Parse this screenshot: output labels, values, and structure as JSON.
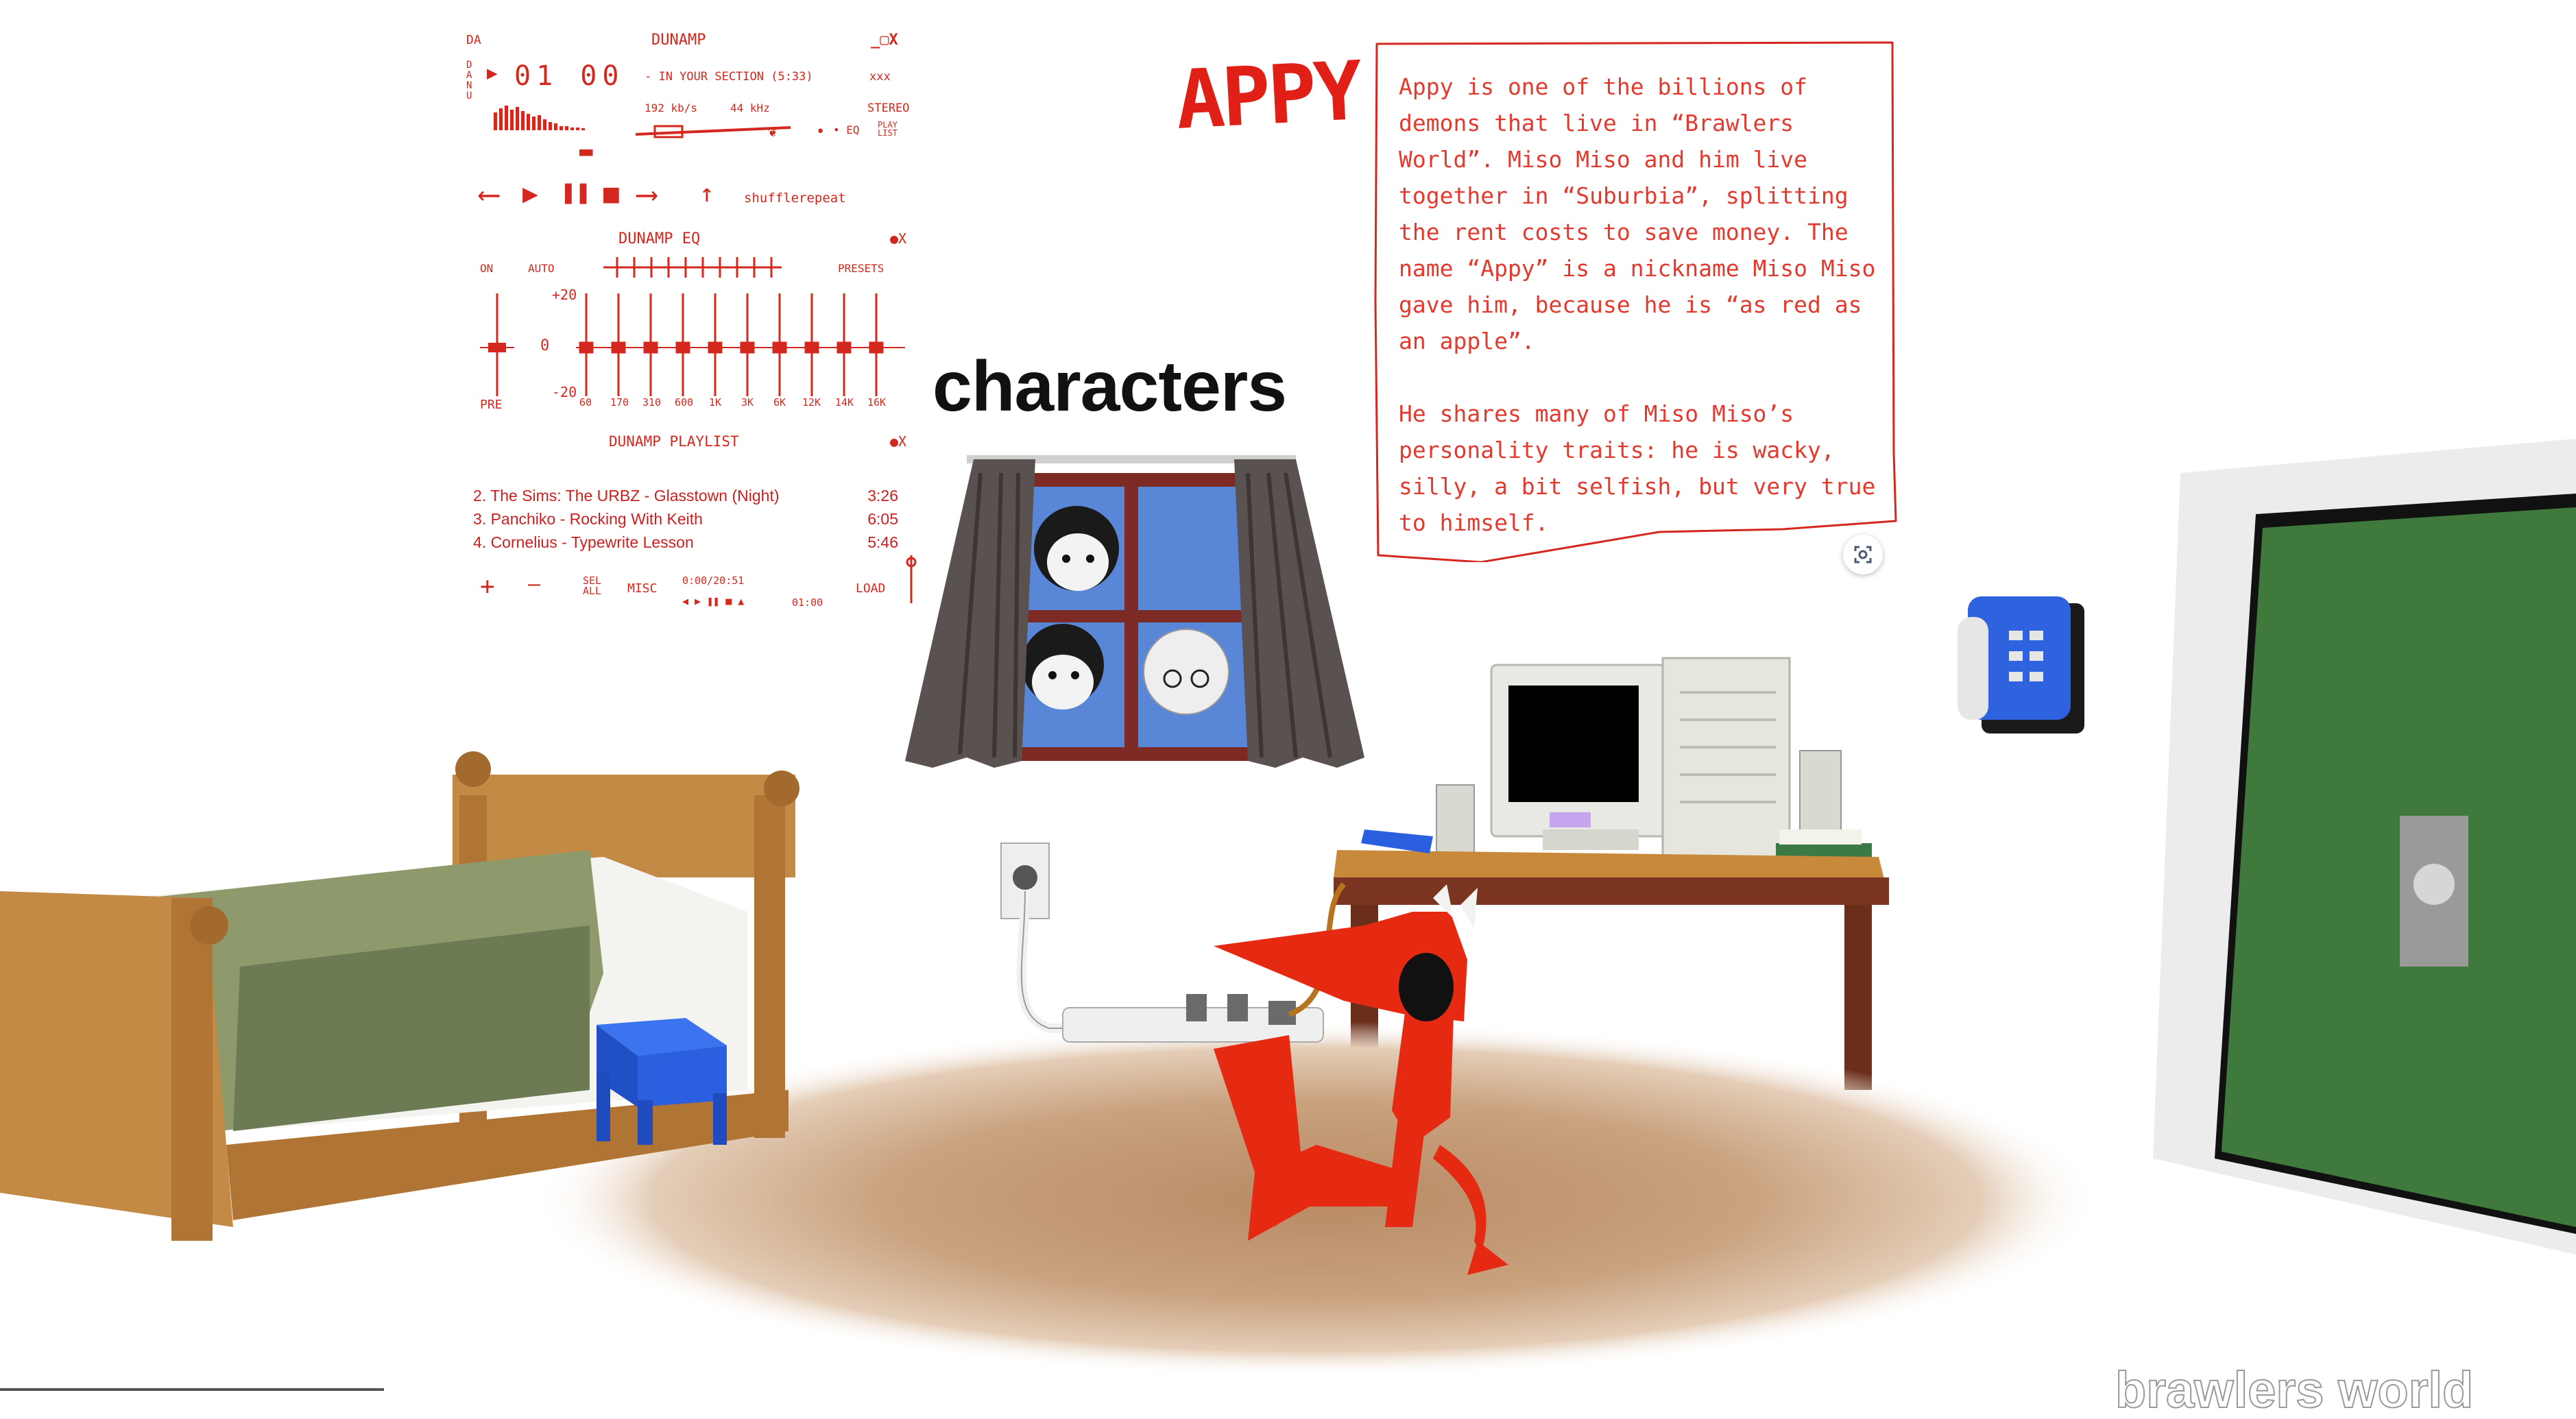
{
  "player": {
    "title": "DUNAMP",
    "window_controls": "_▢X",
    "time": "01 00",
    "track_marquee": "- IN YOUR SECTION (5:33)",
    "marquee_extra": "xxx",
    "bitrate": "192 kb/s",
    "khz": "44 kHz",
    "stereo": "STEREO",
    "playlist_toggle": "PLAY LIST",
    "shuffle": "shuffle",
    "repeat": "repeat",
    "eq": {
      "title": "DUNAMP EQ",
      "on": "ON",
      "auto": "AUTO",
      "presets": "PRESETS",
      "plus": "+20",
      "zero": "0",
      "minus": "-20",
      "pre": "PRE",
      "bands": [
        "60",
        "170",
        "310",
        "600",
        "1K",
        "3K",
        "6K",
        "12K",
        "14K",
        "16K"
      ]
    },
    "playlist": {
      "title": "DUNAMP PLAYLIST",
      "items": [
        {
          "title": "2. The Sims: The URBZ - Glasstown (Night)",
          "duration": "3:26"
        },
        {
          "title": "3. Panchiko - Rocking With Keith",
          "duration": "6:05"
        },
        {
          "title": "4. Cornelius - Typewrite Lesson",
          "duration": "5:46"
        }
      ],
      "add": "+",
      "remove": "—",
      "sel": "SEL ALL",
      "misc": "MISC",
      "time_total": "0:00/20:51",
      "mini_time": "01:00",
      "load": "LOAD"
    }
  },
  "page": {
    "section_title": "characters",
    "brand": "brawlers world"
  },
  "character": {
    "name": "APPY",
    "description": [
      "Appy is one of the billions of demons that live in “Brawlers World”. Miso Miso and him live together in “Suburbia”, splitting the rent costs to save money. The name “Appy” is a nickname Miso Miso gave him, because he is “as red as an apple”.",
      "He shares many of Miso Miso’s personality traits: he is wacky, silly, a bit selfish, but very true to himself."
    ]
  },
  "colors": {
    "accent_red": "#d4281e",
    "door_green": "#3f7a3c",
    "stool_blue": "#2a5fe0"
  },
  "icons": [
    "scan-icon",
    "prev-icon",
    "play-icon",
    "pause-icon",
    "stop-icon",
    "next-icon",
    "eject-icon"
  ]
}
